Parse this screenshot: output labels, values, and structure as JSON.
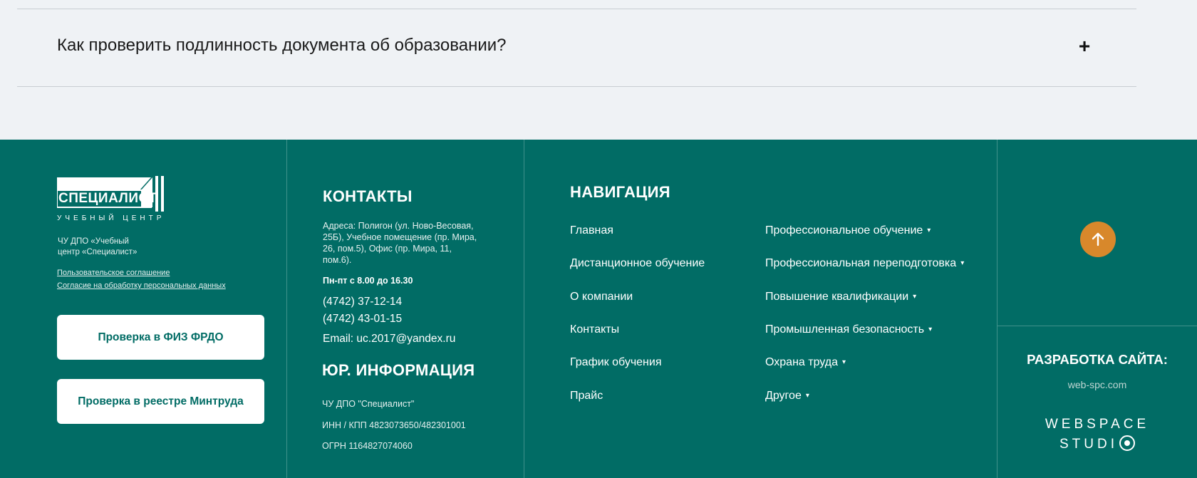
{
  "faq": {
    "question": "Как проверить подлинность документа об образовании?",
    "toggle": "+"
  },
  "footer": {
    "logo": {
      "main": "СПЕЦИАЛИСТ",
      "sub": "УЧЕБНЫЙ ЦЕНТР",
      "org_line1": "ЧУ ДПО «Учебный",
      "org_line2": "центр «Специалист»"
    },
    "links": {
      "agreement": "Пользовательское соглашение",
      "consent": "Согласие на обработку персональных данных"
    },
    "buttons": {
      "frdo": "Проверка в ФИЗ ФРДО",
      "mintrud": "Проверка в реестре Минтруда"
    },
    "contacts": {
      "title": "КОНТАКТЫ",
      "address": "Адреса: Полигон (ул. Ново-Весовая, 25Б), Учебное помещение (пр. Мира, 26, пом.5), Офис (пр. Мира, 11, пом.6).",
      "hours": "Пн-пт с 8.00 до 16.30",
      "phone1": "(4742) 37-12-14",
      "phone2": "(4742) 43-01-15",
      "email_label": "Email:",
      "email": "uc.2017@yandex.ru"
    },
    "legal": {
      "title": "ЮР. ИНФОРМАЦИЯ",
      "name": "ЧУ ДПО \"Специалист\"",
      "inn": "ИНН / КПП 4823073650/482301001",
      "ogrn": "ОГРН 1164827074060"
    },
    "navigation": {
      "title": "НАВИГАЦИЯ",
      "left": [
        "Главная",
        "Дистанционное обучение",
        "О компании",
        "Контакты",
        "График обучения",
        "Прайс"
      ],
      "right": [
        "Профессиональное обучение",
        "Профессиональная переподготовка",
        "Повышение квалификации",
        "Промышленная безопасность",
        "Охрана труда",
        "Другое"
      ],
      "caret": "▾"
    },
    "dev": {
      "title": "РАЗРАБОТКА САЙТА:",
      "link": "web-spc.com",
      "studio_line1": "WEBSPACE",
      "studio_line2": "STUDI"
    }
  },
  "colors": {
    "footer_bg": "#016c65",
    "page_bg": "#eff2f5",
    "accent_orange": "#d8882b"
  },
  "icons": {
    "toggle": "plus-icon",
    "up": "arrow-up-icon",
    "studio": "planet-icon"
  }
}
